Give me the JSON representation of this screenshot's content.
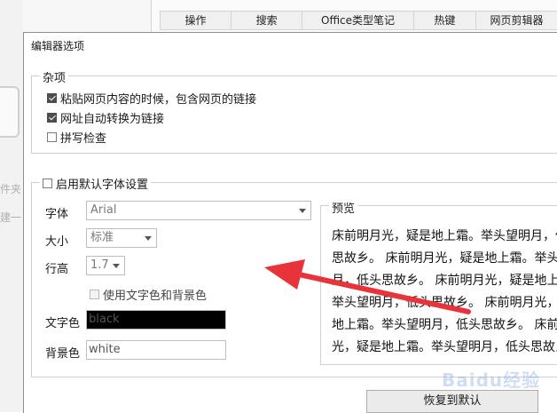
{
  "background": {
    "tabs": [
      "操作",
      "搜索",
      "Office类型笔记",
      "热键",
      "网页剪辑器"
    ],
    "left_fragments": [
      "件夹",
      "建一"
    ]
  },
  "dialog": {
    "title": "编辑器选项",
    "misc": {
      "legend": "杂项",
      "options": [
        {
          "label": "粘贴网页内容的时候，包含网页的链接",
          "checked": true
        },
        {
          "label": "网址自动转换为链接",
          "checked": true
        },
        {
          "label": "拼写检查",
          "checked": false
        }
      ]
    },
    "font_settings": {
      "legend": "启用默认字体设置",
      "enabled": false,
      "font_label": "字体",
      "font_value": "Arial",
      "size_label": "大小",
      "size_value": "标准",
      "line_height_label": "行高",
      "line_height_value": "1.7",
      "use_colors_label": "使用文字色和背景色",
      "use_colors_checked": false,
      "text_color_label": "文字色",
      "text_color_value": "black",
      "bg_color_label": "背景色",
      "bg_color_value": "white"
    },
    "preview": {
      "legend": "预览",
      "text": "床前明月光，疑是地上霜。举头望明月，低头思故乡。 床前明月光，疑是地上霜。举头望明月，低头思故乡。 床前明月光，疑是地上霜。举头望明月，低头思故乡。 床前明月光，疑是地上霜。举头望明月，低头思故乡。 床前明月光，疑是地上霜。举头望明月，低头思故乡。"
    },
    "restore_button": "恢复到默认"
  },
  "colors": {
    "annotation_arrow": "#e8333a",
    "text_color_swatch": "#000000"
  },
  "watermark": "Baidu经验"
}
